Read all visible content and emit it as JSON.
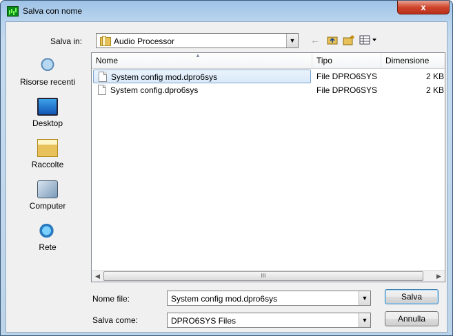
{
  "window": {
    "title": "Salva con nome",
    "close_glyph": "x"
  },
  "toolbar": {
    "save_in_label": "Salva in:",
    "save_in_value": "Audio Processor",
    "icons": [
      "back-arrow-icon",
      "up-folder-icon",
      "new-folder-icon",
      "views-menu-icon"
    ]
  },
  "places": [
    {
      "label": "Risorse recenti",
      "icon": "recent-places-icon"
    },
    {
      "label": "Desktop",
      "icon": "desktop-icon"
    },
    {
      "label": "Raccolte",
      "icon": "libraries-icon"
    },
    {
      "label": "Computer",
      "icon": "computer-icon"
    },
    {
      "label": "Rete",
      "icon": "network-icon"
    }
  ],
  "file_list": {
    "columns": [
      "Nome",
      "Tipo",
      "Dimensione"
    ],
    "rows": [
      {
        "name": "System config mod.dpro6sys",
        "type": "File DPRO6SYS",
        "size": "2 KB",
        "selected": true
      },
      {
        "name": "System config.dpro6sys",
        "type": "File DPRO6SYS",
        "size": "2 KB",
        "selected": false
      }
    ],
    "scrollbar_thumb": "III"
  },
  "form": {
    "file_name_label": "Nome file:",
    "file_name_value": "System config mod.dpro6sys",
    "save_type_label": "Salva come:",
    "save_type_value": "DPRO6SYS Files",
    "save_button": "Salva",
    "cancel_button": "Annulla"
  },
  "colors": {
    "selection": "#d9e9fa",
    "selection_border": "#7da2ce",
    "close_button": "#d0452c",
    "title_bar": "#9ec3e6"
  }
}
